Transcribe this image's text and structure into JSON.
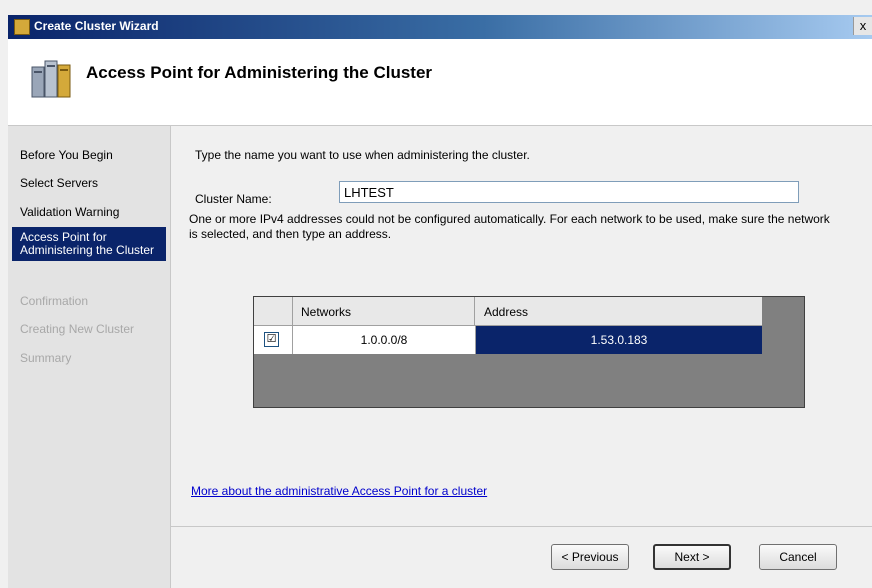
{
  "window": {
    "title": "Create Cluster Wizard",
    "close_label": "x"
  },
  "header": {
    "title": "Access Point for Administering the Cluster",
    "icon": "cluster-icon"
  },
  "steps": [
    {
      "label": "Before You Begin",
      "state": "done"
    },
    {
      "label": "Select Servers",
      "state": "done"
    },
    {
      "label": "Validation Warning",
      "state": "done"
    },
    {
      "label": "Access Point for Administering the Cluster",
      "state": "active"
    },
    {
      "label": "Confirmation",
      "state": "disabled"
    },
    {
      "label": "Creating New Cluster",
      "state": "disabled"
    },
    {
      "label": "Summary",
      "state": "disabled"
    }
  ],
  "main": {
    "instruction": "Type the name you want to use when administering the cluster.",
    "cluster_name_label": "Cluster Name:",
    "cluster_name_value": "LHTEST",
    "info_text": "One or more IPv4 addresses could not be configured automatically.  For each network to be used, make sure the network is selected, and then type an address.",
    "grid": {
      "columns": [
        "Networks",
        "Address"
      ],
      "rows": [
        {
          "checked": true,
          "check_glyph": "☑",
          "network": "1.0.0.0/8",
          "address": "1.53.0.183"
        }
      ]
    },
    "help_link": "More about the administrative Access Point for a cluster"
  },
  "buttons": {
    "previous": "< Previous",
    "next": "Next >",
    "cancel": "Cancel"
  },
  "colors": {
    "title_bar": "#0a246a",
    "selection": "#0a246a",
    "link": "#0000cc"
  }
}
